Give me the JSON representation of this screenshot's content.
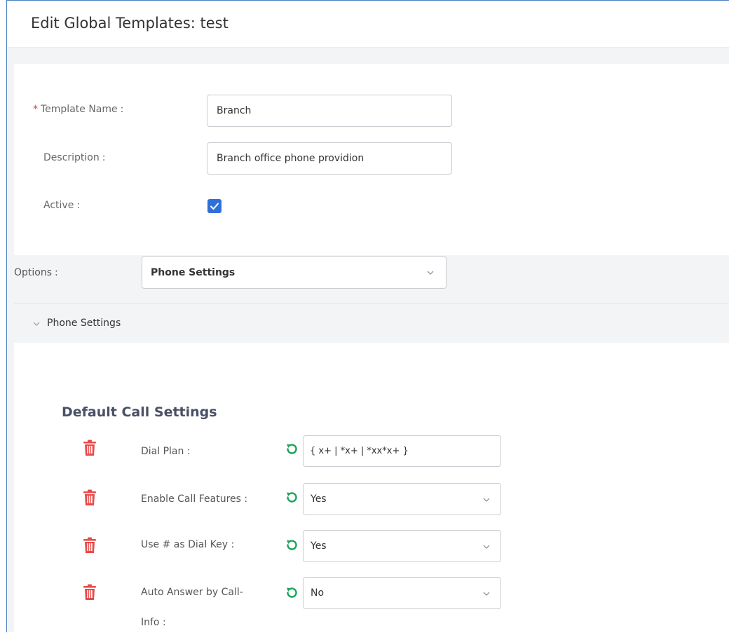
{
  "page": {
    "title": "Edit Global Templates: test"
  },
  "form": {
    "template_name": {
      "label": "Template Name",
      "colon": ":",
      "value": "Branch"
    },
    "description": {
      "label": "Description",
      "colon": ":",
      "value": "Branch office phone providion"
    },
    "active": {
      "label": "Active",
      "colon": ":",
      "checked": true
    }
  },
  "options": {
    "label": "Options",
    "colon": ":",
    "selected": "Phone Settings"
  },
  "panel": {
    "title": "Phone Settings"
  },
  "section": {
    "title": "Default Call Settings",
    "rows": [
      {
        "label": "Dial Plan :",
        "value": "{ x+ | *x+ | *xx*x+ }",
        "type": "input"
      },
      {
        "label": "Enable Call Features :",
        "value": "Yes",
        "type": "select"
      },
      {
        "label": "Use # as Dial Key :",
        "value": "Yes",
        "type": "select"
      },
      {
        "label": "Auto Answer by Call-",
        "label2": "Info :",
        "value": "No",
        "type": "select"
      }
    ]
  },
  "colors": {
    "accent": "#2f6fd8",
    "danger": "#e84a4a",
    "reset": "#1aa35a",
    "frame": "#4a7fc1"
  }
}
